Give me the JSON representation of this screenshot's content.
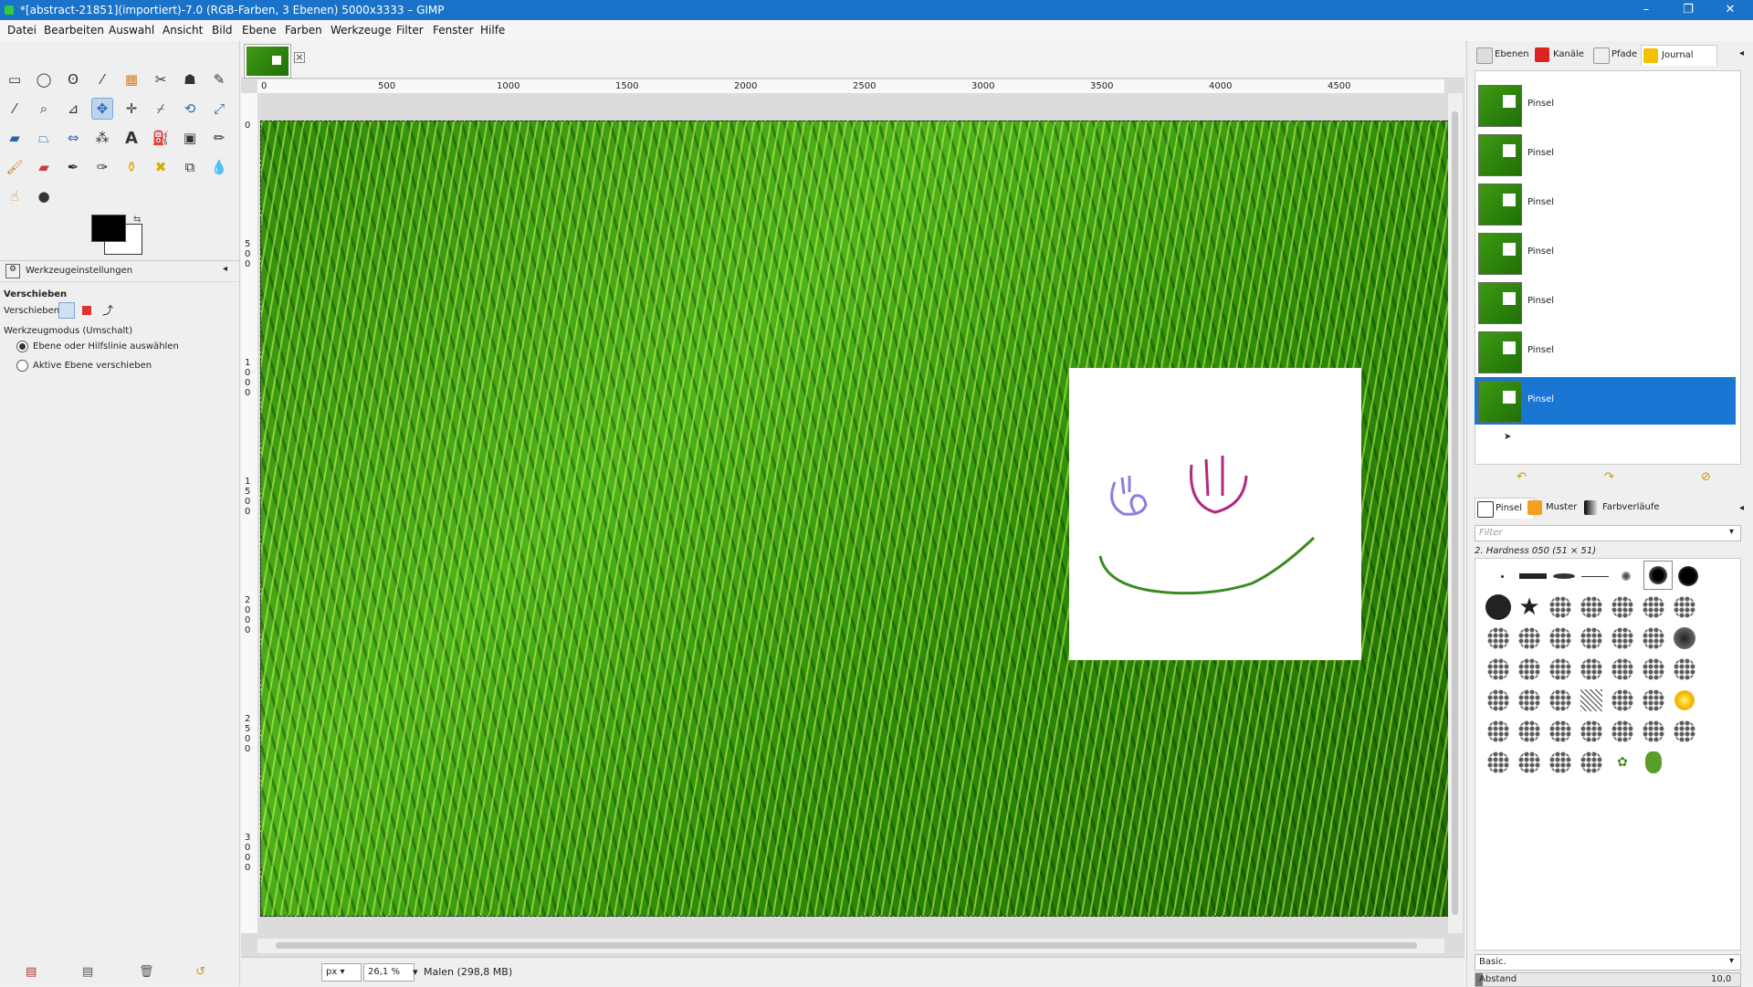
{
  "window": {
    "title": "*[abstract-21851](importiert)-7.0 (RGB-Farben, 3 Ebenen) 5000x3333 – GIMP",
    "minimize": "–",
    "restore": "❐",
    "close": "✕"
  },
  "menu": [
    "Datei",
    "Bearbeiten",
    "Auswahl",
    "Ansicht",
    "Bild",
    "Ebene",
    "Farben",
    "Werkzeuge",
    "Filter",
    "Fenster",
    "Hilfe"
  ],
  "tool_options": {
    "tab_label": "Werkzeugeinstellungen",
    "tool_name": "Verschieben",
    "move_label": "Verschieben:",
    "mode_label": "Werkzeugmodus (Umschalt)",
    "option1": "Ebene oder Hilfslinie auswählen",
    "option2": "Aktive Ebene verschieben",
    "selected_option": "option1"
  },
  "ruler": {
    "top_ticks": [
      "0",
      "500",
      "1000",
      "1500",
      "2000",
      "2500",
      "3000",
      "3500",
      "4000",
      "4500"
    ],
    "left_ticks": [
      "0",
      "500",
      "1000",
      "1500",
      "2000",
      "2500",
      "3000"
    ]
  },
  "status": {
    "unit": "px",
    "zoom": "26,1 %",
    "message": "Malen (298,8 MB)"
  },
  "dock_tabs": {
    "layers": "Ebenen",
    "channels": "Kanäle",
    "paths": "Pfade",
    "history": "Journal"
  },
  "history": {
    "items": [
      "Pinsel",
      "Pinsel",
      "Pinsel",
      "Pinsel",
      "Pinsel",
      "Pinsel",
      "Pinsel"
    ],
    "selected_index": 6
  },
  "brushes": {
    "tabs": {
      "brushes": "Pinsel",
      "patterns": "Muster",
      "gradients": "Farbverläufe"
    },
    "filter_placeholder": "Filter",
    "current_brush": "2. Hardness 050 (51 × 51)",
    "preset": "Basic.",
    "spacing_label": "Abstand",
    "spacing_value": "10,0"
  },
  "colors": {
    "titlebar": "#1a73c8",
    "selected": "#1976d2",
    "fg": "#000000",
    "bg": "#ffffff"
  }
}
